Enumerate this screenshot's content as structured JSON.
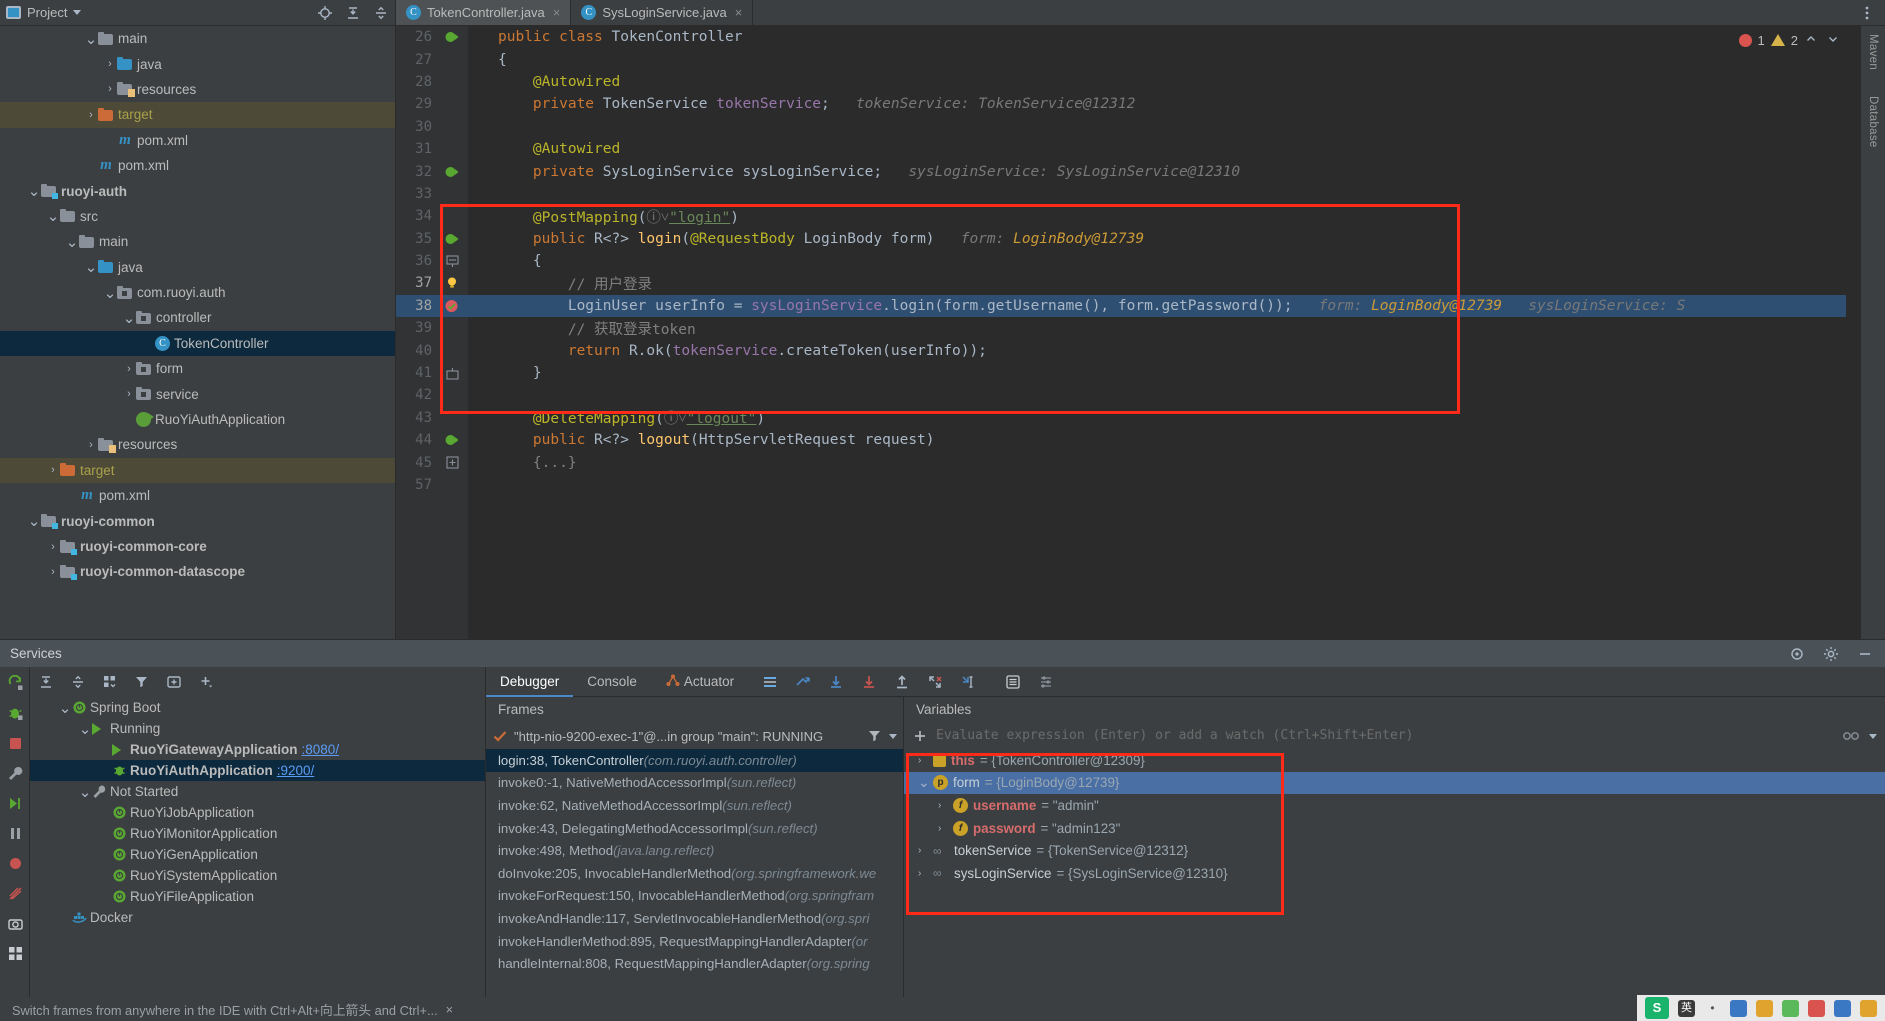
{
  "project_panel": {
    "title": "Project",
    "icons": [
      "locate-icon",
      "expand-all-icon",
      "collapse-all-icon"
    ],
    "tree": [
      {
        "indent": 4,
        "arrow": "down",
        "icon": "folder",
        "label": "main",
        "style": "plain"
      },
      {
        "indent": 5,
        "arrow": "right",
        "icon": "folder-blue",
        "label": "java",
        "style": "plain"
      },
      {
        "indent": 5,
        "arrow": "right",
        "icon": "folder-res",
        "label": "resources",
        "style": "plain"
      },
      {
        "indent": 4,
        "arrow": "right",
        "icon": "folder-orange",
        "label": "target",
        "style": "target"
      },
      {
        "indent": 5,
        "arrow": "none",
        "icon": "maven",
        "label": "pom.xml",
        "style": "plain"
      },
      {
        "indent": 4,
        "arrow": "none",
        "icon": "maven",
        "label": "pom.xml",
        "style": "plain"
      },
      {
        "indent": 1,
        "arrow": "down",
        "icon": "folder-module",
        "label": "ruoyi-auth",
        "style": "bold"
      },
      {
        "indent": 2,
        "arrow": "down",
        "icon": "folder",
        "label": "src",
        "style": "plain"
      },
      {
        "indent": 3,
        "arrow": "down",
        "icon": "folder",
        "label": "main",
        "style": "plain"
      },
      {
        "indent": 4,
        "arrow": "down",
        "icon": "folder-blue",
        "label": "java",
        "style": "plain"
      },
      {
        "indent": 5,
        "arrow": "down",
        "icon": "package",
        "label": "com.ruoyi.auth",
        "style": "plain"
      },
      {
        "indent": 6,
        "arrow": "down",
        "icon": "package",
        "label": "controller",
        "style": "plain"
      },
      {
        "indent": 7,
        "arrow": "none",
        "icon": "class",
        "label": "TokenController",
        "style": "selected"
      },
      {
        "indent": 6,
        "arrow": "right",
        "icon": "package",
        "label": "form",
        "style": "plain"
      },
      {
        "indent": 6,
        "arrow": "right",
        "icon": "package",
        "label": "service",
        "style": "plain"
      },
      {
        "indent": 6,
        "arrow": "none",
        "icon": "spring-class",
        "label": "RuoYiAuthApplication",
        "style": "plain"
      },
      {
        "indent": 4,
        "arrow": "right",
        "icon": "folder-res",
        "label": "resources",
        "style": "plain"
      },
      {
        "indent": 2,
        "arrow": "right",
        "icon": "folder-orange",
        "label": "target",
        "style": "target"
      },
      {
        "indent": 3,
        "arrow": "none",
        "icon": "maven",
        "label": "pom.xml",
        "style": "plain"
      },
      {
        "indent": 1,
        "arrow": "down",
        "icon": "folder-module",
        "label": "ruoyi-common",
        "style": "bold"
      },
      {
        "indent": 2,
        "arrow": "right",
        "icon": "folder-module",
        "label": "ruoyi-common-core",
        "style": "bold"
      },
      {
        "indent": 2,
        "arrow": "right",
        "icon": "folder-module",
        "label": "ruoyi-common-datascope",
        "style": "bold"
      }
    ]
  },
  "editor": {
    "tabs": [
      {
        "label": "TokenController.java",
        "active": true,
        "icon": "java-class-icon",
        "close": "×"
      },
      {
        "label": "SysLoginService.java",
        "active": false,
        "icon": "java-class-icon",
        "close": "×"
      }
    ],
    "inspection": {
      "error_count": "1",
      "warning_count": "2"
    },
    "lines": [
      {
        "num": "26",
        "gutter": "spring-bean",
        "segments": [
          {
            "t": "public ",
            "c": "kw"
          },
          {
            "t": "class ",
            "c": "kw"
          },
          {
            "t": "TokenController",
            "c": "cls"
          }
        ]
      },
      {
        "num": "27",
        "gutter": "",
        "segments": [
          {
            "t": "{",
            "c": "pun"
          }
        ]
      },
      {
        "num": "28",
        "gutter": "",
        "segments": [
          {
            "t": "    ",
            "c": "pun"
          },
          {
            "t": "@Autowired",
            "c": "ann"
          }
        ]
      },
      {
        "num": "29",
        "gutter": "",
        "segments": [
          {
            "t": "    ",
            "c": "pun"
          },
          {
            "t": "private ",
            "c": "kw"
          },
          {
            "t": "TokenService ",
            "c": "cls"
          },
          {
            "t": "tokenService",
            "c": "fld"
          },
          {
            "t": ";",
            "c": "pun"
          },
          {
            "t": "   tokenService: TokenService@12312",
            "c": "hint"
          }
        ]
      },
      {
        "num": "30",
        "gutter": "",
        "segments": []
      },
      {
        "num": "31",
        "gutter": "",
        "segments": [
          {
            "t": "    ",
            "c": "pun"
          },
          {
            "t": "@Autowired",
            "c": "ann"
          }
        ]
      },
      {
        "num": "32",
        "gutter": "spring-nav",
        "segments": [
          {
            "t": "    ",
            "c": "pun"
          },
          {
            "t": "private ",
            "c": "kw"
          },
          {
            "t": "SysLoginService ",
            "c": "cls"
          },
          {
            "t": "sysLoginService",
            "c": "cls"
          },
          {
            "t": ";",
            "c": "pun"
          },
          {
            "t": "   sysLoginService: SysLoginService@12310",
            "c": "hint"
          }
        ]
      },
      {
        "num": "33",
        "gutter": "",
        "segments": []
      },
      {
        "num": "34",
        "gutter": "",
        "segments": [
          {
            "t": "    ",
            "c": "pun"
          },
          {
            "t": "@PostMapping",
            "c": "ann"
          },
          {
            "t": "(",
            "c": "pun"
          },
          {
            "t": "ⓘ˅",
            "c": "cm"
          },
          {
            "t": "\"login\"",
            "c": "str under"
          },
          {
            "t": ")",
            "c": "pun"
          }
        ]
      },
      {
        "num": "35",
        "gutter": "spring-endpoint",
        "segments": [
          {
            "t": "    ",
            "c": "pun"
          },
          {
            "t": "public ",
            "c": "kw"
          },
          {
            "t": "R<?> ",
            "c": "cls"
          },
          {
            "t": "login",
            "c": "mth"
          },
          {
            "t": "(",
            "c": "pun"
          },
          {
            "t": "@RequestBody ",
            "c": "ann"
          },
          {
            "t": "LoginBody form",
            "c": "cls"
          },
          {
            "t": ")",
            "c": "pun"
          },
          {
            "t": "   form: ",
            "c": "hint"
          },
          {
            "t": "LoginBody@12739",
            "c": "hintv"
          }
        ]
      },
      {
        "num": "36",
        "gutter": "fold-start",
        "segments": [
          {
            "t": "    {",
            "c": "pun"
          }
        ]
      },
      {
        "num": "37",
        "gutter": "bulb",
        "current": true,
        "segments": [
          {
            "t": "        ",
            "c": "pun"
          },
          {
            "t": "// 用户登录",
            "c": "cm"
          }
        ]
      },
      {
        "num": "38",
        "gutter": "breakpoint",
        "highlight": true,
        "segments": [
          {
            "t": "        ",
            "c": "pun"
          },
          {
            "t": "LoginUser ",
            "c": "cls"
          },
          {
            "t": "userInfo ",
            "c": "cls"
          },
          {
            "t": "= ",
            "c": "pun"
          },
          {
            "t": "sysLoginService",
            "c": "fld"
          },
          {
            "t": ".",
            "c": "pun"
          },
          {
            "t": "login",
            "c": "cls"
          },
          {
            "t": "(form.",
            "c": "pun"
          },
          {
            "t": "getUsername",
            "c": "cls"
          },
          {
            "t": "(), form.",
            "c": "pun"
          },
          {
            "t": "getPassword",
            "c": "cls"
          },
          {
            "t": "());",
            "c": "pun"
          },
          {
            "t": "   form: ",
            "c": "hint"
          },
          {
            "t": "LoginBody@12739",
            "c": "hintv"
          },
          {
            "t": "   sysLoginService: S",
            "c": "hint"
          }
        ]
      },
      {
        "num": "39",
        "gutter": "",
        "segments": [
          {
            "t": "        ",
            "c": "pun"
          },
          {
            "t": "// 获取登录token",
            "c": "cm"
          }
        ]
      },
      {
        "num": "40",
        "gutter": "",
        "segments": [
          {
            "t": "        ",
            "c": "pun"
          },
          {
            "t": "return ",
            "c": "kw"
          },
          {
            "t": "R.",
            "c": "cls"
          },
          {
            "t": "ok",
            "c": "cls"
          },
          {
            "t": "(",
            "c": "pun"
          },
          {
            "t": "tokenService",
            "c": "fld"
          },
          {
            "t": ".",
            "c": "pun"
          },
          {
            "t": "createToken",
            "c": "cls"
          },
          {
            "t": "(userInfo));",
            "c": "pun"
          }
        ]
      },
      {
        "num": "41",
        "gutter": "fold-end",
        "segments": [
          {
            "t": "    }",
            "c": "pun"
          }
        ]
      },
      {
        "num": "42",
        "gutter": "",
        "segments": []
      },
      {
        "num": "43",
        "gutter": "",
        "segments": [
          {
            "t": "    ",
            "c": "pun"
          },
          {
            "t": "@DeleteMapping",
            "c": "ann"
          },
          {
            "t": "(",
            "c": "pun"
          },
          {
            "t": "ⓘ˅",
            "c": "cm"
          },
          {
            "t": "\"logout\"",
            "c": "str under"
          },
          {
            "t": ")",
            "c": "pun"
          }
        ]
      },
      {
        "num": "44",
        "gutter": "spring-nav",
        "segments": [
          {
            "t": "    ",
            "c": "pun"
          },
          {
            "t": "public ",
            "c": "kw"
          },
          {
            "t": "R<?> ",
            "c": "cls"
          },
          {
            "t": "logout",
            "c": "mth"
          },
          {
            "t": "(",
            "c": "pun"
          },
          {
            "t": "HttpServletRequest request",
            "c": "cls"
          },
          {
            "t": ")",
            "c": "pun"
          }
        ]
      },
      {
        "num": "45",
        "gutter": "fold-collapsed",
        "segments": [
          {
            "t": "    {...}",
            "c": "cm"
          }
        ]
      },
      {
        "num": "57",
        "gutter": "",
        "segments": []
      }
    ]
  },
  "right_strip": {
    "labels": [
      "Maven",
      "Database"
    ]
  },
  "services_header": {
    "title": "Services",
    "icons": [
      "settings-icon",
      "gear-icon",
      "minimize-icon"
    ]
  },
  "services_panel": {
    "toolbar_icons": [
      "rerun-icon",
      "expand-all-icon",
      "collapse-all-icon",
      "group-icon",
      "filter-icon",
      "add-tab-icon",
      "add-icon"
    ],
    "side_icons": [
      "run-icon",
      "debug-icon",
      "stop-icon",
      "settings-wrench-icon",
      "step-icon",
      "pause-icon",
      "camera-icon",
      "profile-icon",
      "screenshot-icon",
      "grid-icon"
    ],
    "tree": [
      {
        "indent": 1,
        "arrow": "down",
        "icon": "spring-boot",
        "label": "Spring Boot",
        "port": "",
        "style": "plain"
      },
      {
        "indent": 2,
        "arrow": "down",
        "icon": "run",
        "label": "Running",
        "port": "",
        "style": "plain"
      },
      {
        "indent": 3,
        "arrow": "none",
        "icon": "run",
        "label": "RuoYiGatewayApplication",
        "port": ":8080/",
        "style": "bold"
      },
      {
        "indent": 3,
        "arrow": "none",
        "icon": "debug",
        "label": "RuoYiAuthApplication",
        "port": ":9200/",
        "style": "selected"
      },
      {
        "indent": 2,
        "arrow": "down",
        "icon": "wrench",
        "label": "Not Started",
        "port": "",
        "style": "plain"
      },
      {
        "indent": 3,
        "arrow": "none",
        "icon": "spring-boot",
        "label": "RuoYiJobApplication",
        "port": "",
        "style": "plain"
      },
      {
        "indent": 3,
        "arrow": "none",
        "icon": "spring-boot",
        "label": "RuoYiMonitorApplication",
        "port": "",
        "style": "plain"
      },
      {
        "indent": 3,
        "arrow": "none",
        "icon": "spring-boot",
        "label": "RuoYiGenApplication",
        "port": "",
        "style": "plain"
      },
      {
        "indent": 3,
        "arrow": "none",
        "icon": "spring-boot",
        "label": "RuoYiSystemApplication",
        "port": "",
        "style": "plain"
      },
      {
        "indent": 3,
        "arrow": "none",
        "icon": "spring-boot",
        "label": "RuoYiFileApplication",
        "port": "",
        "style": "plain"
      },
      {
        "indent": 1,
        "arrow": "none",
        "icon": "docker",
        "label": "Docker",
        "port": "",
        "style": "plain"
      }
    ]
  },
  "debugger": {
    "tabs": [
      {
        "label": "Debugger",
        "active": true
      },
      {
        "label": "Console",
        "active": false
      },
      {
        "label": "Actuator",
        "active": false,
        "icon": "actuator-icon"
      }
    ],
    "toolbar_icons": [
      "layout-icon",
      "step-over-icon",
      "step-into-icon",
      "force-step-into-icon",
      "step-out-icon",
      "drop-frame-icon",
      "run-to-cursor-icon",
      "evaluate-icon",
      "settings-icon"
    ],
    "frames_title": "Frames",
    "thread": {
      "label": "\"http-nio-9200-exec-1\"@...in group \"main\": RUNNING",
      "icons": [
        "filter-icon",
        "dropdown-icon"
      ]
    },
    "frames": [
      {
        "main": "login:38, TokenController",
        "sub": "(com.ruoyi.auth.controller)",
        "selected": true
      },
      {
        "main": "invoke0:-1, NativeMethodAccessorImpl",
        "sub": "(sun.reflect)",
        "selected": false
      },
      {
        "main": "invoke:62, NativeMethodAccessorImpl",
        "sub": "(sun.reflect)",
        "selected": false
      },
      {
        "main": "invoke:43, DelegatingMethodAccessorImpl",
        "sub": "(sun.reflect)",
        "selected": false
      },
      {
        "main": "invoke:498, Method",
        "sub": "(java.lang.reflect)",
        "selected": false
      },
      {
        "main": "doInvoke:205, InvocableHandlerMethod",
        "sub": "(org.springframework.we",
        "selected": false
      },
      {
        "main": "invokeForRequest:150, InvocableHandlerMethod",
        "sub": "(org.springfram",
        "selected": false
      },
      {
        "main": "invokeAndHandle:117, ServletInvocableHandlerMethod",
        "sub": "(org.spri",
        "selected": false
      },
      {
        "main": "invokeHandlerMethod:895, RequestMappingHandlerAdapter",
        "sub": "(or",
        "selected": false
      },
      {
        "main": "handleInternal:808, RequestMappingHandlerAdapter",
        "sub": "(org.spring",
        "selected": false
      }
    ],
    "hint_text": "Switch frames from anywhere in the IDE with Ctrl+Alt+向上箭头 and Ctrl+...",
    "hint_close": "×",
    "variables_title": "Variables",
    "evaluate_placeholder": "Evaluate expression (Enter) or add a watch (Ctrl+Shift+Enter)",
    "variables": [
      {
        "arrow": "right",
        "icon": "stack-icon",
        "name": "this",
        "name_style": "red",
        "value": "= {TokenController@12309}",
        "selected": false
      },
      {
        "arrow": "down",
        "icon": "param-icon",
        "name": "form",
        "name_style": "plain",
        "value": "= {LoginBody@12739}",
        "selected": true
      },
      {
        "arrow": "right",
        "icon": "field-icon",
        "name": "username",
        "name_style": "red",
        "value": "= \"admin\"",
        "selected": false,
        "indent": 1
      },
      {
        "arrow": "right",
        "icon": "field-icon",
        "name": "password",
        "name_style": "red",
        "value": "= \"admin123\"",
        "selected": false,
        "indent": 1
      },
      {
        "arrow": "right",
        "icon": "object-icon",
        "name": "tokenService",
        "name_style": "plain",
        "value": "= {TokenService@12312}",
        "selected": false
      },
      {
        "arrow": "right",
        "icon": "object-icon",
        "name": "sysLoginService",
        "name_style": "plain",
        "value": "= {SysLoginService@12310}",
        "selected": false
      }
    ]
  },
  "colors": {
    "accent_red": "#ff2a17",
    "selection_blue": "#4a6fa5",
    "tree_selection": "#0d293e",
    "code_highlight": "#2f4f72",
    "link_blue": "#589df6",
    "background": "#3c3f41",
    "editor_bg": "#2b2b2b"
  }
}
